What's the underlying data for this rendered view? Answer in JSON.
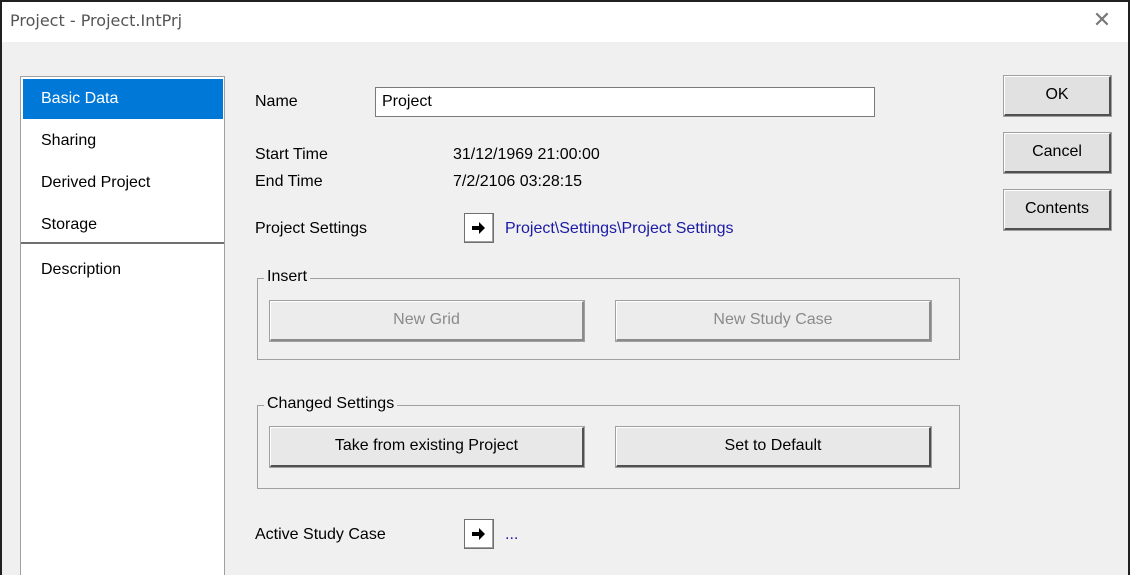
{
  "window": {
    "title": "Project - Project.IntPrj",
    "close_glyph": "✕"
  },
  "sidebar": {
    "items": [
      {
        "label": "Basic Data"
      },
      {
        "label": "Sharing"
      },
      {
        "label": "Derived Project"
      },
      {
        "label": "Storage"
      },
      {
        "label": "Description"
      }
    ],
    "selected": "Basic Data"
  },
  "form": {
    "name_label": "Name",
    "name_value": "Project",
    "start_time_label": "Start Time",
    "start_time_value": "31/12/1969 21:00:00",
    "end_time_label": "End Time",
    "end_time_value": "7/2/2106 03:28:15",
    "project_settings_label": "Project Settings",
    "project_settings_link": "Project\\Settings\\Project Settings",
    "active_study_case_label": "Active Study Case",
    "active_study_case_value": "..."
  },
  "insert_group": {
    "title": "Insert",
    "new_grid_label": "New Grid",
    "new_study_case_label": "New Study Case"
  },
  "changed_settings_group": {
    "title": "Changed Settings",
    "take_from_existing_label": "Take from existing Project",
    "set_to_default_label": "Set to Default"
  },
  "actions": {
    "ok_label": "OK",
    "cancel_label": "Cancel",
    "contents_label": "Contents"
  },
  "colors": {
    "selection": "#0078d7",
    "link": "#1a1aa6",
    "dialog_bg": "#f0f0f0"
  },
  "icons": {
    "arrow": "arrow-right-icon",
    "close": "close-icon"
  }
}
